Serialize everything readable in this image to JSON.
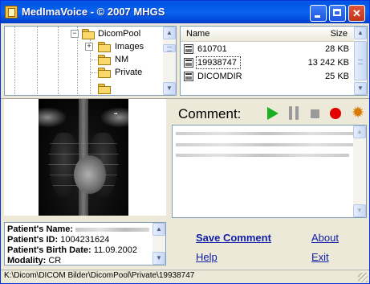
{
  "window": {
    "title": "MedImaVoice - © 2007 MHGS",
    "minimize_label": "",
    "maximize_label": "",
    "close_label": "✕"
  },
  "folder_tree": {
    "items": [
      {
        "label": "DicomPool",
        "expander": "−"
      },
      {
        "label": "Images",
        "expander": "+"
      },
      {
        "label": "NM",
        "expander": ""
      },
      {
        "label": "Private",
        "expander": ""
      }
    ]
  },
  "file_list": {
    "columns": {
      "name": "Name",
      "size": "Size"
    },
    "rows": [
      {
        "name": "610701",
        "size": "28 KB"
      },
      {
        "name": "19938747",
        "size": "13 242 KB",
        "selected": true
      },
      {
        "name": "DICOMDIR",
        "size": "25 KB"
      }
    ]
  },
  "comment": {
    "label": "Comment:",
    "controls": {
      "play": "play-icon",
      "pause": "pause-icon",
      "stop": "stop-icon",
      "record": "record-icon",
      "settings": "gear-icon",
      "settings_glyph": "✹"
    },
    "text": ""
  },
  "patient": {
    "name_label": "Patient's Name:",
    "name_value": "",
    "id_label": "Patient's ID:",
    "id_value": "1004231624",
    "birth_label": "Patient's Birth Date:",
    "birth_value": "11.09.2002",
    "modality_label": "Modality:",
    "modality_value": "CR"
  },
  "actions": {
    "save_comment": "Save Comment",
    "about": "About",
    "help": "Help",
    "exit": "Exit"
  },
  "status": {
    "path": "K:\\Dicom\\DICOM Bilder\\DicomPool\\Private\\19938747"
  },
  "colors": {
    "title_bar": "#0054e3",
    "play": "#18b020",
    "record": "#e00000",
    "gear": "#d87a00",
    "link": "#1020a8"
  }
}
